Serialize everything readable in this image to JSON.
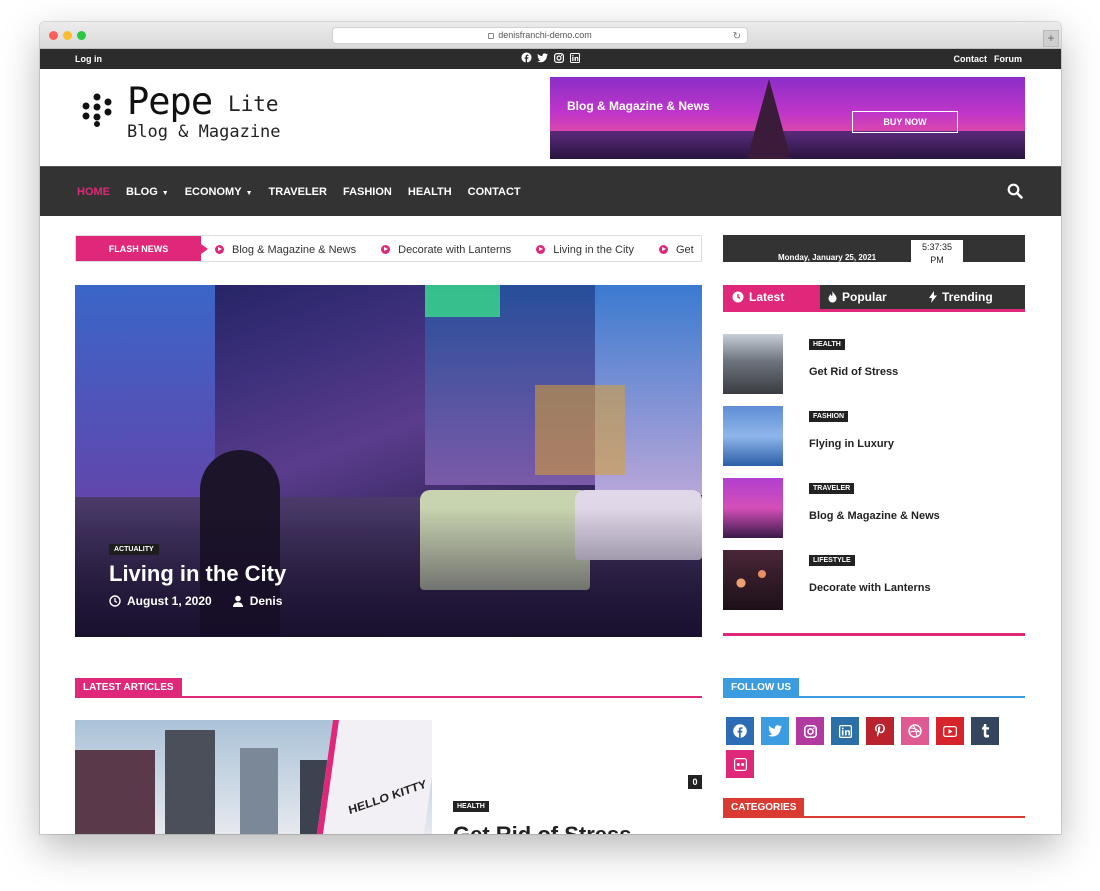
{
  "browser": {
    "url": "denisfranchi-demo.com"
  },
  "topbar": {
    "login": "Log in",
    "links": [
      "Contact",
      "Forum"
    ],
    "social_icons": [
      "facebook-icon",
      "twitter-icon",
      "instagram-icon",
      "linkedin-icon"
    ]
  },
  "logo": {
    "title": "Pepe",
    "suffix": "Lite",
    "subtitle": "Blog & Magazine"
  },
  "banner": {
    "text": "Blog & Magazine & News",
    "button": "BUY NOW"
  },
  "nav": {
    "items": [
      {
        "label": "HOME",
        "active": true,
        "dropdown": false
      },
      {
        "label": "BLOG",
        "active": false,
        "dropdown": true
      },
      {
        "label": "ECONOMY",
        "active": false,
        "dropdown": true
      },
      {
        "label": "TRAVELER",
        "active": false,
        "dropdown": false
      },
      {
        "label": "FASHION",
        "active": false,
        "dropdown": false
      },
      {
        "label": "HEALTH",
        "active": false,
        "dropdown": false
      },
      {
        "label": "CONTACT",
        "active": false,
        "dropdown": false
      }
    ]
  },
  "flash": {
    "label": "FLASH NEWS",
    "items": [
      "Blog & Magazine & News",
      "Decorate with Lanterns",
      "Living in the City",
      "Get"
    ]
  },
  "clock": {
    "date": "Monday, January 25, 2021",
    "time": "5:37:35",
    "ampm": "PM"
  },
  "hero": {
    "category": "ACTUALITY",
    "title": "Living in the City",
    "date": "August 1, 2020",
    "author": "Denis"
  },
  "sidebar": {
    "tabs": {
      "latest": "Latest",
      "popular": "Popular",
      "trending": "Trending"
    },
    "posts": [
      {
        "category": "HEALTH",
        "title": "Get Rid of Stress"
      },
      {
        "category": "FASHION",
        "title": "Flying in Luxury"
      },
      {
        "category": "TRAVELER",
        "title": "Blog & Magazine & News"
      },
      {
        "category": "LIFESTYLE",
        "title": "Decorate with Lanterns"
      }
    ],
    "follow": "FOLLOW US",
    "categories": "CATEGORIES",
    "social": [
      "facebook-icon",
      "twitter-icon",
      "instagram-icon",
      "linkedin-icon",
      "pinterest-icon",
      "dribbble-icon",
      "youtube-icon",
      "tumblr-icon",
      "flickr-icon"
    ]
  },
  "latest": {
    "heading": "LATEST ARTICLES",
    "comment_count": "0",
    "article": {
      "category": "HEALTH",
      "title": "Get Rid of Stress",
      "image_text": "HELLO KITTY"
    }
  },
  "colors": {
    "accent": "#e0287a",
    "dark": "#333333",
    "follow": "#3b9ce0",
    "categories": "#d93a32"
  }
}
